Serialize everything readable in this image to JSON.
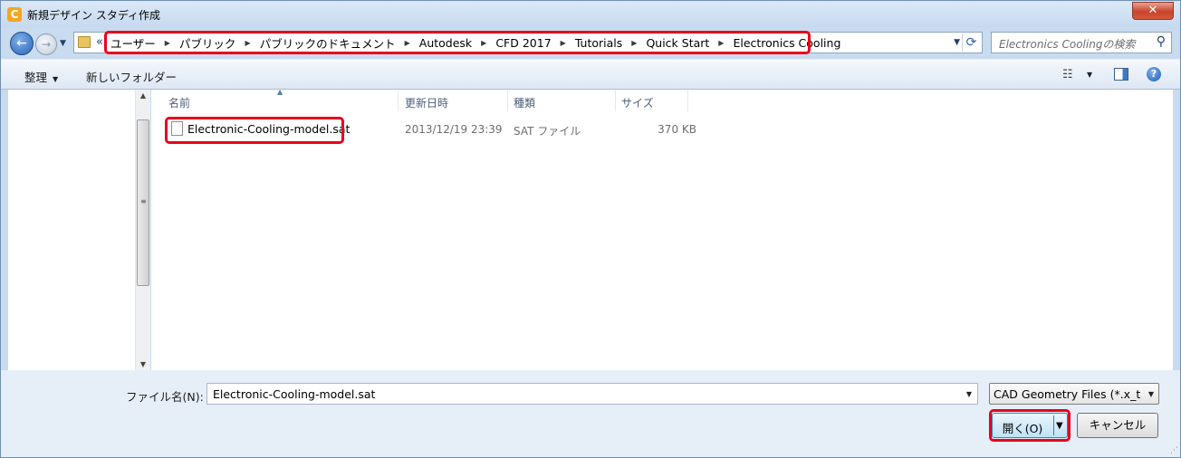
{
  "window": {
    "title": "新規デザイン スタディ作成",
    "close_label": "✕"
  },
  "address": {
    "prefix": "«",
    "crumbs": [
      "ユーザー",
      "パブリック",
      "パブリックのドキュメント",
      "Autodesk",
      "CFD 2017",
      "Tutorials",
      "Quick Start",
      "Electronics Cooling"
    ]
  },
  "search": {
    "placeholder": "Electronics Coolingの検索"
  },
  "toolbar": {
    "organize": "整理",
    "new_folder": "新しいフォルダー"
  },
  "columns": {
    "name": "名前",
    "date": "更新日時",
    "type": "種類",
    "size": "サイズ"
  },
  "files": [
    {
      "name": "Electronic-Cooling-model.sat",
      "date": "2013/12/19 23:39",
      "type": "SAT ファイル",
      "size": "370 KB"
    }
  ],
  "footer": {
    "filename_label": "ファイル名(N):",
    "filename_value": "Electronic-Cooling-model.sat",
    "filter_value": "CAD Geometry Files (*.x_t *",
    "open_label": "開く(O)",
    "cancel_label": "キャンセル"
  },
  "colors": {
    "highlight": "#e8001c",
    "accent": "#2a64b8"
  }
}
